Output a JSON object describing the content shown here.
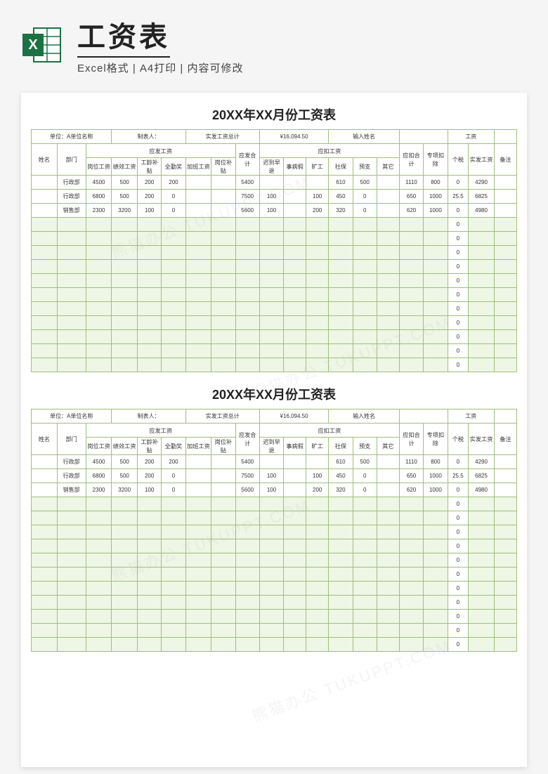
{
  "header": {
    "title": "工资表",
    "subtitle": "Excel格式 | A4打印 | 内容可修改",
    "icon_name": "excel-icon"
  },
  "sheet": {
    "title": "20XX年XX月份工资表",
    "info": {
      "unit_label": "单位：A单位名称",
      "maker_label": "制表人：",
      "total_label": "实发工资总计",
      "total_value": "¥16,094.50",
      "name_label": "输入姓名",
      "salary_label": "工资"
    },
    "headers": {
      "name": "姓名",
      "dept": "部门",
      "payable_group": "应发工资",
      "payable_total": "应发合计",
      "deduct_group": "应扣工资",
      "deduct_total": "应扣合计",
      "special": "专项扣除",
      "tax": "个税",
      "net": "实发工资",
      "remark": "备注",
      "pay_cols": [
        "岗位工资",
        "绩效工资",
        "工龄补贴",
        "全勤奖",
        "加班工资",
        "岗位补贴"
      ],
      "ded_cols": [
        "迟到早退",
        "事病假",
        "旷工",
        "社保",
        "预支",
        "其它"
      ]
    },
    "rows": [
      {
        "name": "",
        "dept": "行政部",
        "pay": [
          "4500",
          "500",
          "200",
          "200",
          "",
          ""
        ],
        "ptotal": "5400",
        "ded": [
          "",
          "",
          "",
          "610",
          "500",
          ""
        ],
        "dtotal": "1110",
        "special": "800",
        "tax": "0",
        "net": "4290",
        "remark": ""
      },
      {
        "name": "",
        "dept": "行政部",
        "pay": [
          "6800",
          "500",
          "200",
          "0",
          "",
          ""
        ],
        "ptotal": "7500",
        "ded": [
          "100",
          "",
          "100",
          "450",
          "0",
          ""
        ],
        "dtotal": "650",
        "special": "1000",
        "tax": "25.5",
        "net": "6825",
        "remark": ""
      },
      {
        "name": "",
        "dept": "销售部",
        "pay": [
          "2300",
          "3200",
          "100",
          "0",
          "",
          ""
        ],
        "ptotal": "5600",
        "ded": [
          "100",
          "",
          "200",
          "320",
          "0",
          ""
        ],
        "dtotal": "620",
        "special": "1000",
        "tax": "0",
        "net": "4980",
        "remark": ""
      }
    ],
    "empty_tax_zero": "0",
    "empty_row_count": 11
  },
  "chart_data": {
    "type": "table",
    "title": "20XX年XX月份工资表",
    "columns": [
      "姓名",
      "部门",
      "岗位工资",
      "绩效工资",
      "工龄补贴",
      "全勤奖",
      "加班工资",
      "岗位补贴",
      "应发合计",
      "迟到早退",
      "事病假",
      "旷工",
      "社保",
      "预支",
      "其它",
      "应扣合计",
      "专项扣除",
      "个税",
      "实发工资",
      "备注"
    ],
    "rows": [
      [
        "",
        "行政部",
        4500,
        500,
        200,
        200,
        null,
        null,
        5400,
        null,
        null,
        null,
        610,
        500,
        null,
        1110,
        800,
        0,
        4290,
        ""
      ],
      [
        "",
        "行政部",
        6800,
        500,
        200,
        0,
        null,
        null,
        7500,
        100,
        null,
        100,
        450,
        0,
        null,
        650,
        1000,
        25.5,
        6825,
        ""
      ],
      [
        "",
        "销售部",
        2300,
        3200,
        100,
        0,
        null,
        null,
        5600,
        100,
        null,
        200,
        320,
        0,
        null,
        620,
        1000,
        0,
        4980,
        ""
      ]
    ],
    "summary": {
      "实发工资总计": 16094.5
    }
  }
}
